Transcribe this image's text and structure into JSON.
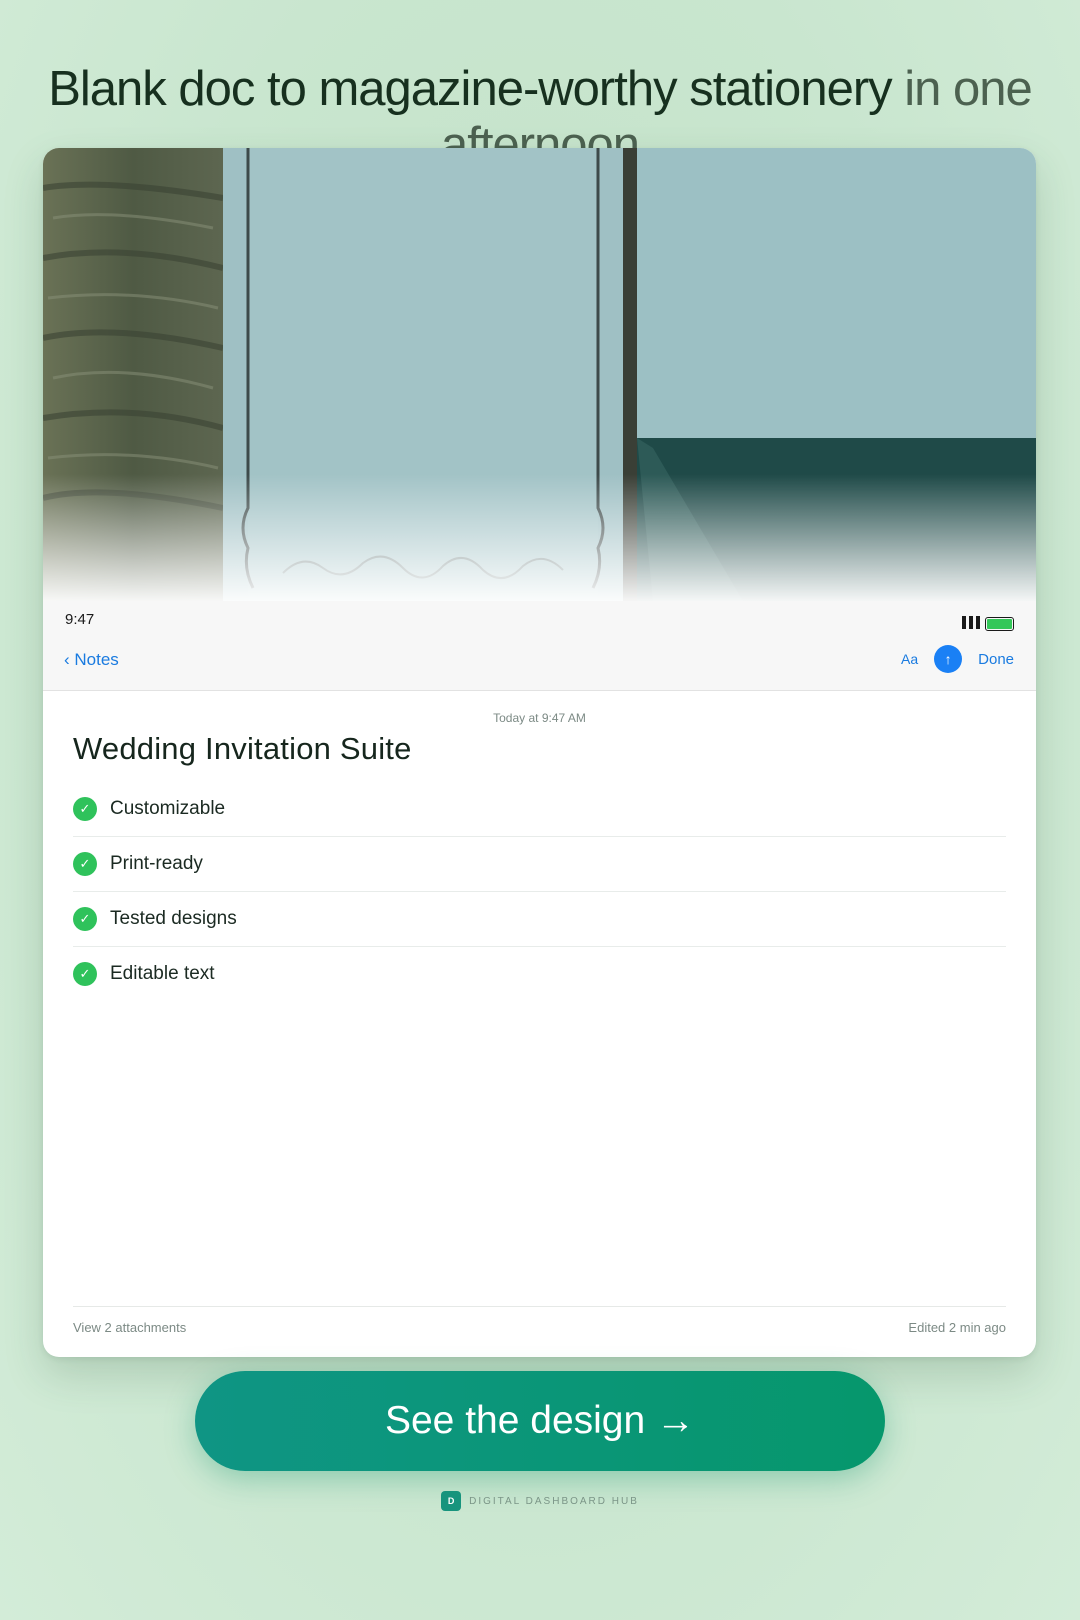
{
  "headline": {
    "main": "Blank doc to magazine-worthy stationery",
    "muted": "in one afternoon"
  },
  "status_bar": {
    "time": "9:47"
  },
  "nav": {
    "back_label": "Notes",
    "format_label": "Aa",
    "share_icon": "share-icon",
    "done_label": "Done"
  },
  "note": {
    "timestamp": "Today at 9:47 AM",
    "title": "Wedding Invitation Suite",
    "checklist": [
      "Customizable",
      "Print-ready",
      "Tested designs",
      "Editable text"
    ]
  },
  "footer": {
    "attachments_label": "View 2 attachments",
    "edited_label": "Edited 2 min ago"
  },
  "cta": {
    "label": "See the design →"
  },
  "brand": {
    "logo_letter": "D",
    "name": "DIGITAL DASHBOARD HUB"
  },
  "colors": {
    "accent_blue": "#1a7be0",
    "check_green": "#2fc25b",
    "cta_teal": "#0f9584",
    "headline_dark": "#17301f"
  }
}
